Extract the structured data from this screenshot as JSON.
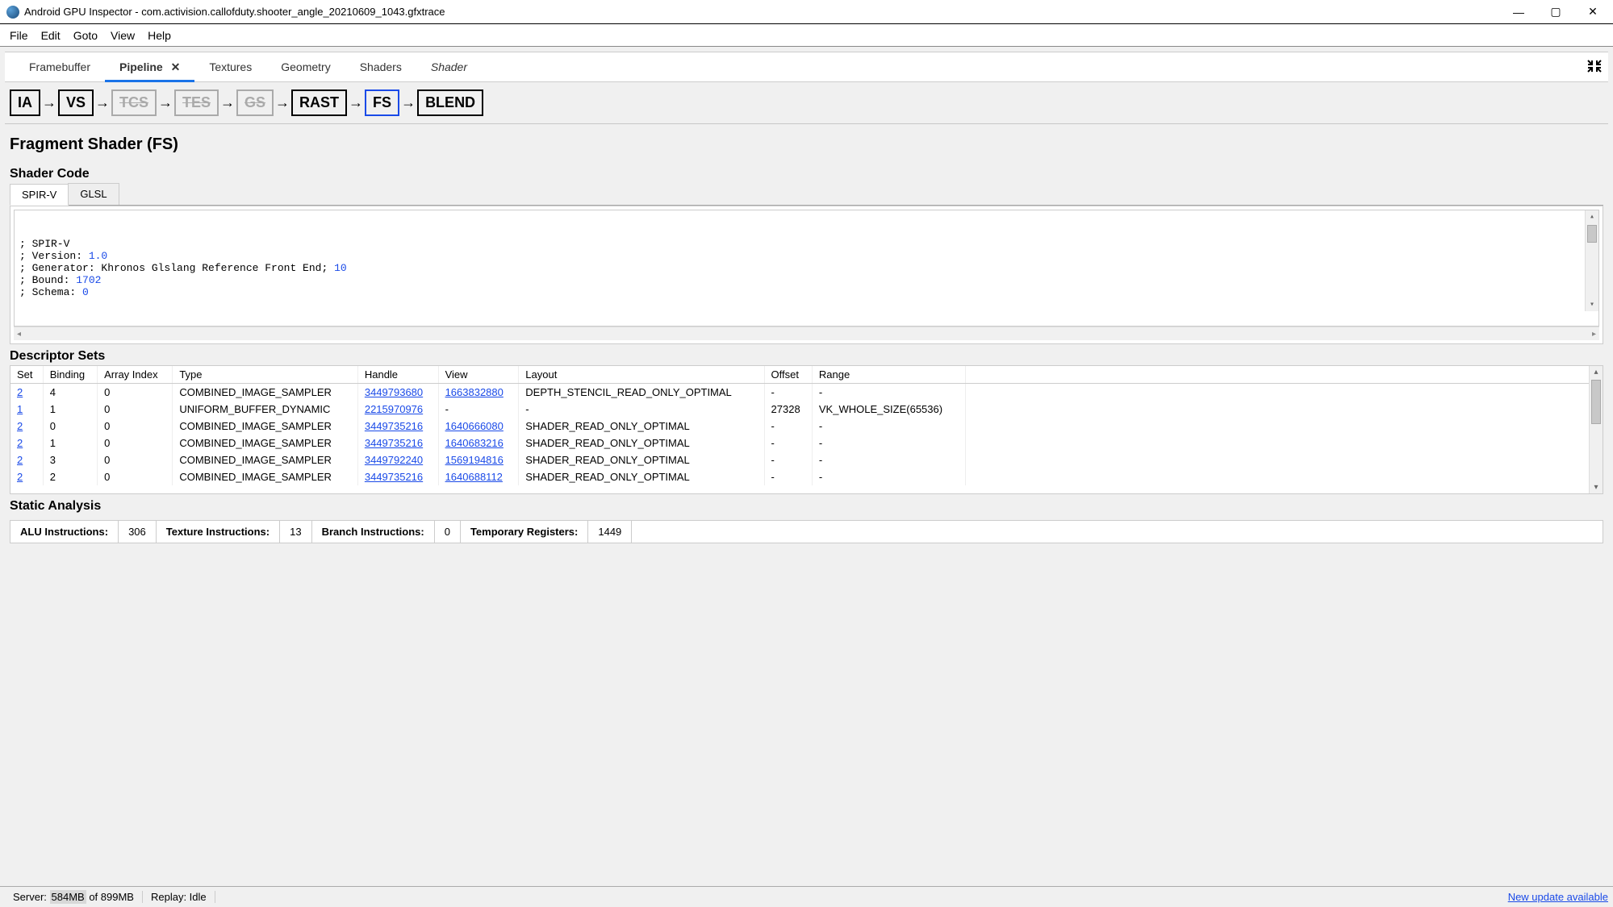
{
  "window": {
    "title": "Android GPU Inspector - com.activision.callofduty.shooter_angle_20210609_1043.gfxtrace"
  },
  "menu": {
    "items": [
      "File",
      "Edit",
      "Goto",
      "View",
      "Help"
    ]
  },
  "tabs": {
    "items": [
      "Framebuffer",
      "Pipeline",
      "Textures",
      "Geometry",
      "Shaders",
      "Shader"
    ],
    "active": "Pipeline",
    "italic": "Shader"
  },
  "pipeline": {
    "stages": [
      {
        "id": "IA",
        "disabled": false
      },
      {
        "id": "VS",
        "disabled": false
      },
      {
        "id": "TCS",
        "disabled": true
      },
      {
        "id": "TES",
        "disabled": true
      },
      {
        "id": "GS",
        "disabled": true
      },
      {
        "id": "RAST",
        "disabled": false
      },
      {
        "id": "FS",
        "disabled": false,
        "selected": true
      },
      {
        "id": "BLEND",
        "disabled": false
      }
    ]
  },
  "heading": "Fragment Shader (FS)",
  "shader_code": {
    "title": "Shader Code",
    "tabs": [
      "SPIR-V",
      "GLSL"
    ],
    "active": "SPIR-V",
    "lines": [
      {
        "pre": "; SPIR-V",
        "hl": ""
      },
      {
        "pre": "; Version: ",
        "hl": "1.0"
      },
      {
        "pre": "; Generator: Khronos Glslang Reference Front End; ",
        "hl": "10"
      },
      {
        "pre": "; Bound: ",
        "hl": "1702"
      },
      {
        "pre": "; Schema: ",
        "hl": "0"
      }
    ]
  },
  "descriptor_sets": {
    "title": "Descriptor Sets",
    "headers": [
      "Set",
      "Binding",
      "Array Index",
      "Type",
      "Handle",
      "View",
      "Layout",
      "Offset",
      "Range"
    ],
    "rows": [
      {
        "set": "2",
        "binding": "4",
        "ai": "0",
        "type": "COMBINED_IMAGE_SAMPLER",
        "handle": "3449793680",
        "view": "1663832880",
        "layout": "DEPTH_STENCIL_READ_ONLY_OPTIMAL",
        "offset": "-",
        "range": "-"
      },
      {
        "set": "1",
        "binding": "1",
        "ai": "0",
        "type": "UNIFORM_BUFFER_DYNAMIC",
        "handle": "2215970976",
        "view": "-",
        "layout": "-",
        "offset": "27328",
        "range": "VK_WHOLE_SIZE(65536)"
      },
      {
        "set": "2",
        "binding": "0",
        "ai": "0",
        "type": "COMBINED_IMAGE_SAMPLER",
        "handle": "3449735216",
        "view": "1640666080",
        "layout": "SHADER_READ_ONLY_OPTIMAL",
        "offset": "-",
        "range": "-"
      },
      {
        "set": "2",
        "binding": "1",
        "ai": "0",
        "type": "COMBINED_IMAGE_SAMPLER",
        "handle": "3449735216",
        "view": "1640683216",
        "layout": "SHADER_READ_ONLY_OPTIMAL",
        "offset": "-",
        "range": "-"
      },
      {
        "set": "2",
        "binding": "3",
        "ai": "0",
        "type": "COMBINED_IMAGE_SAMPLER",
        "handle": "3449792240",
        "view": "1569194816",
        "layout": "SHADER_READ_ONLY_OPTIMAL",
        "offset": "-",
        "range": "-"
      },
      {
        "set": "2",
        "binding": "2",
        "ai": "0",
        "type": "COMBINED_IMAGE_SAMPLER",
        "handle": "3449735216",
        "view": "1640688112",
        "layout": "SHADER_READ_ONLY_OPTIMAL",
        "offset": "-",
        "range": "-"
      }
    ]
  },
  "static_analysis": {
    "title": "Static Analysis",
    "metrics": [
      {
        "label": "ALU Instructions:",
        "value": "306"
      },
      {
        "label": "Texture Instructions:",
        "value": "13"
      },
      {
        "label": "Branch Instructions:",
        "value": "0"
      },
      {
        "label": "Temporary Registers:",
        "value": "1449"
      }
    ]
  },
  "status": {
    "server_prefix": "Server: ",
    "server_hl": "584MB",
    "server_suffix": " of 899MB",
    "replay": "Replay:  Idle",
    "update": "New update available"
  }
}
